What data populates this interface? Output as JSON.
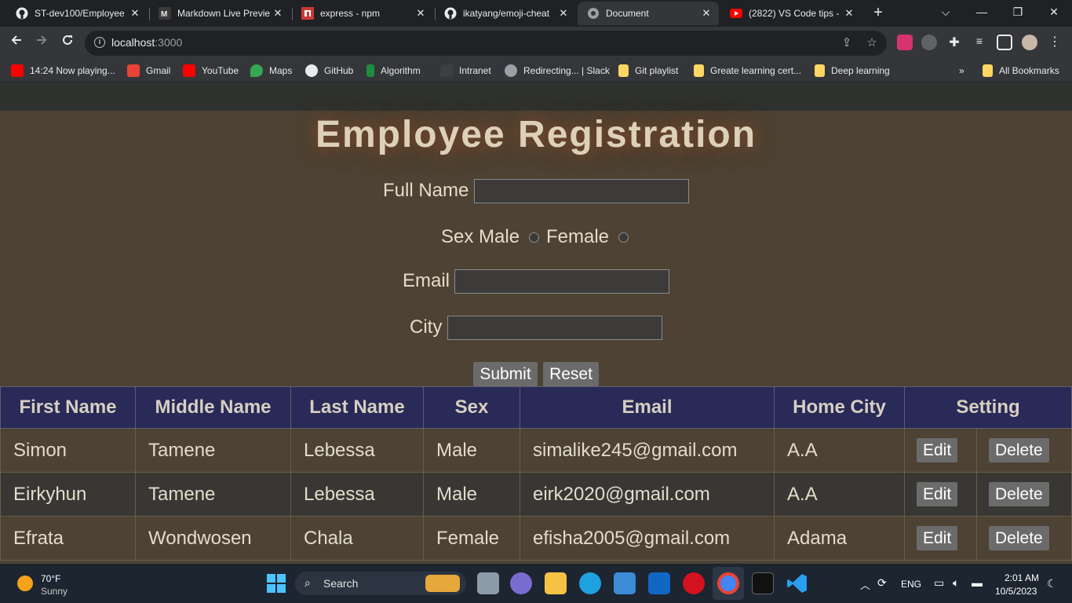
{
  "browser": {
    "tabs": [
      {
        "title": "ST-dev100/Employee"
      },
      {
        "title": "Markdown Live Previe"
      },
      {
        "title": "express - npm"
      },
      {
        "title": "ikatyang/emoji-cheat"
      },
      {
        "title": "Document"
      },
      {
        "title": "(2822) VS Code tips -"
      }
    ],
    "url_host": "localhost",
    "url_port": ":3000",
    "bookmarks": [
      "14:24 Now playing...",
      "Gmail",
      "YouTube",
      "Maps",
      "GitHub",
      "Algorithm",
      "Intranet",
      "Redirecting... | Slack",
      "Git playlist",
      "Greate learning cert...",
      "Deep learning",
      "All Bookmarks"
    ]
  },
  "form": {
    "title": "Employee Registration",
    "full_name_label": "Full Name",
    "sex_label": "Sex Male",
    "female_label": "Female",
    "email_label": "Email",
    "city_label": "City",
    "submit_label": "Submit",
    "reset_label": "Reset"
  },
  "table": {
    "headers": [
      "First Name",
      "Middle Name",
      "Last Name",
      "Sex",
      "Email",
      "Home City",
      "Setting"
    ],
    "edit_label": "Edit",
    "delete_label": "Delete",
    "rows": [
      [
        "Simon",
        "Tamene",
        "Lebessa",
        "Male",
        "simalike245@gmail.com",
        "A.A"
      ],
      [
        "Eirkyhun",
        "Tamene",
        "Lebessa",
        "Male",
        "eirk2020@gmail.com",
        "A.A"
      ],
      [
        "Efrata",
        "Wondwosen",
        "Chala",
        "Female",
        "efisha2005@gmail.com",
        "Adama"
      ]
    ]
  },
  "taskbar": {
    "weather_temp": "70°F",
    "weather_desc": "Sunny",
    "search_label": "Search",
    "lang": "ENG",
    "time": "2:01 AM",
    "date": "10/5/2023"
  }
}
